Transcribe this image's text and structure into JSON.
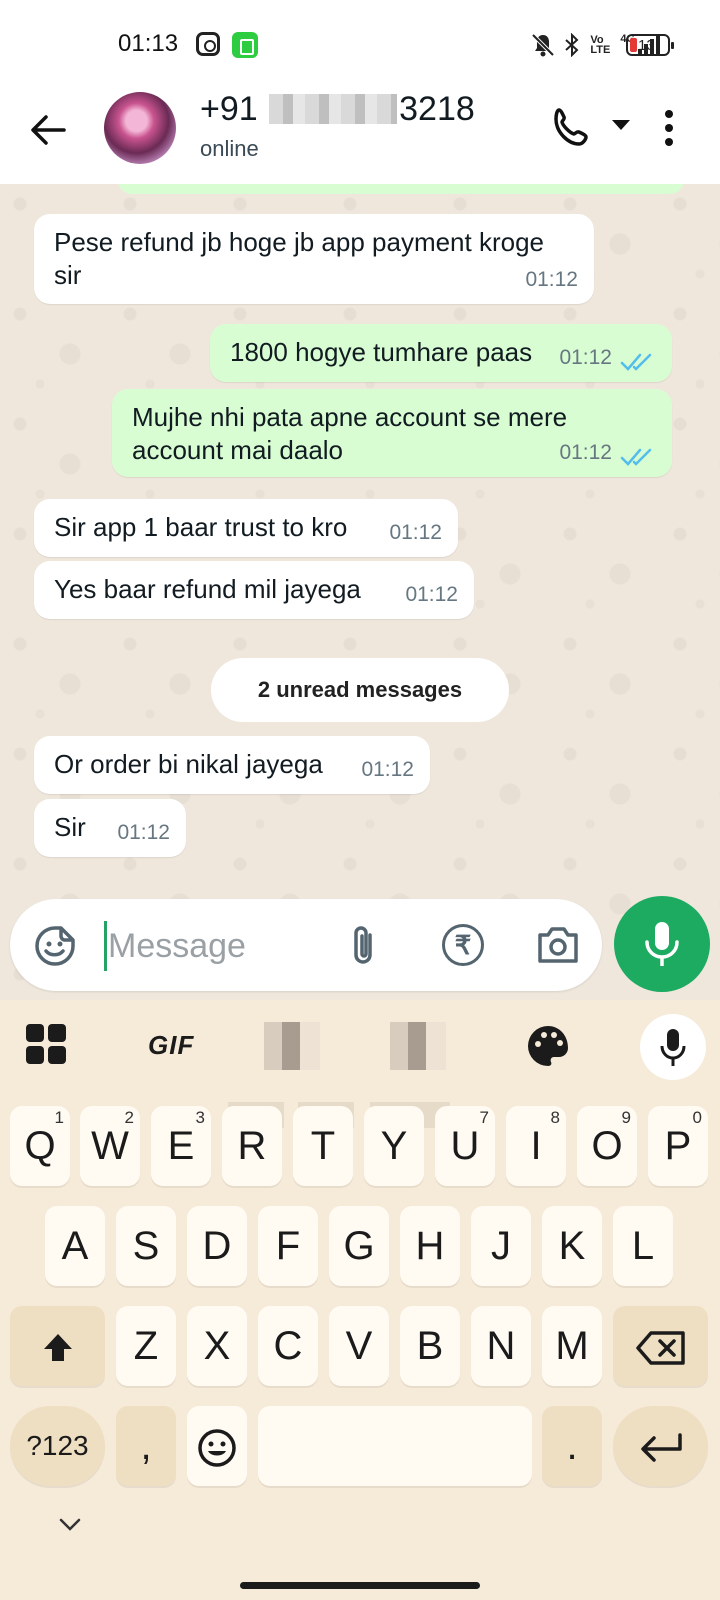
{
  "status_bar": {
    "time": "01:13",
    "icons": [
      "instagram-icon",
      "app-notification-icon",
      "mute-icon",
      "bluetooth-icon",
      "volte-icon",
      "4g-signal-icon"
    ],
    "volte": "Vo\nLTE",
    "network": "4G",
    "battery": "13",
    "battery_color": "#e53935"
  },
  "header": {
    "contact_name_prefix": "+91",
    "contact_name_suffix": "3218",
    "status": "online"
  },
  "messages": [
    {
      "direction": "in",
      "text": "Pese refund jb hoge jb app payment kroge sir",
      "time": "01:12"
    },
    {
      "direction": "out",
      "text": "1800 hogye tumhare paas",
      "time": "01:12",
      "read": true
    },
    {
      "direction": "out",
      "text": "Mujhe nhi pata apne account se mere account mai daalo",
      "time": "01:12",
      "read": true
    },
    {
      "direction": "in",
      "text": "Sir app 1 baar trust to kro",
      "time": "01:12"
    },
    {
      "direction": "in",
      "text": "Yes baar refund mil jayega",
      "time": "01:12"
    },
    {
      "direction": "in",
      "text": "Or order bi nikal jayega",
      "time": "01:12"
    },
    {
      "direction": "in",
      "text": "Sir",
      "time": "01:12"
    }
  ],
  "unread_divider": "2 unread messages",
  "composer": {
    "placeholder": "Message",
    "rupee_symbol": "₹"
  },
  "keyboard": {
    "gif_label": "GIF",
    "row1": [
      {
        "key": "Q",
        "hint": "1"
      },
      {
        "key": "W",
        "hint": "2"
      },
      {
        "key": "E",
        "hint": "3"
      },
      {
        "key": "R",
        "hint": ""
      },
      {
        "key": "T",
        "hint": ""
      },
      {
        "key": "Y",
        "hint": ""
      },
      {
        "key": "U",
        "hint": "7"
      },
      {
        "key": "I",
        "hint": "8"
      },
      {
        "key": "O",
        "hint": "9"
      },
      {
        "key": "P",
        "hint": "0"
      }
    ],
    "row2": [
      "A",
      "S",
      "D",
      "F",
      "G",
      "H",
      "J",
      "K",
      "L"
    ],
    "row3": [
      "Z",
      "X",
      "C",
      "V",
      "B",
      "N",
      "M"
    ],
    "symbols_key": "?123",
    "comma_key": ",",
    "period_key": "."
  },
  "colors": {
    "outgoing_bubble": "#d9fdd3",
    "incoming_bubble": "#ffffff",
    "chat_background": "#efe7dc",
    "accent_green": "#1daa61",
    "read_tick_blue": "#53bdeb",
    "keyboard_background": "#f6ead8"
  }
}
